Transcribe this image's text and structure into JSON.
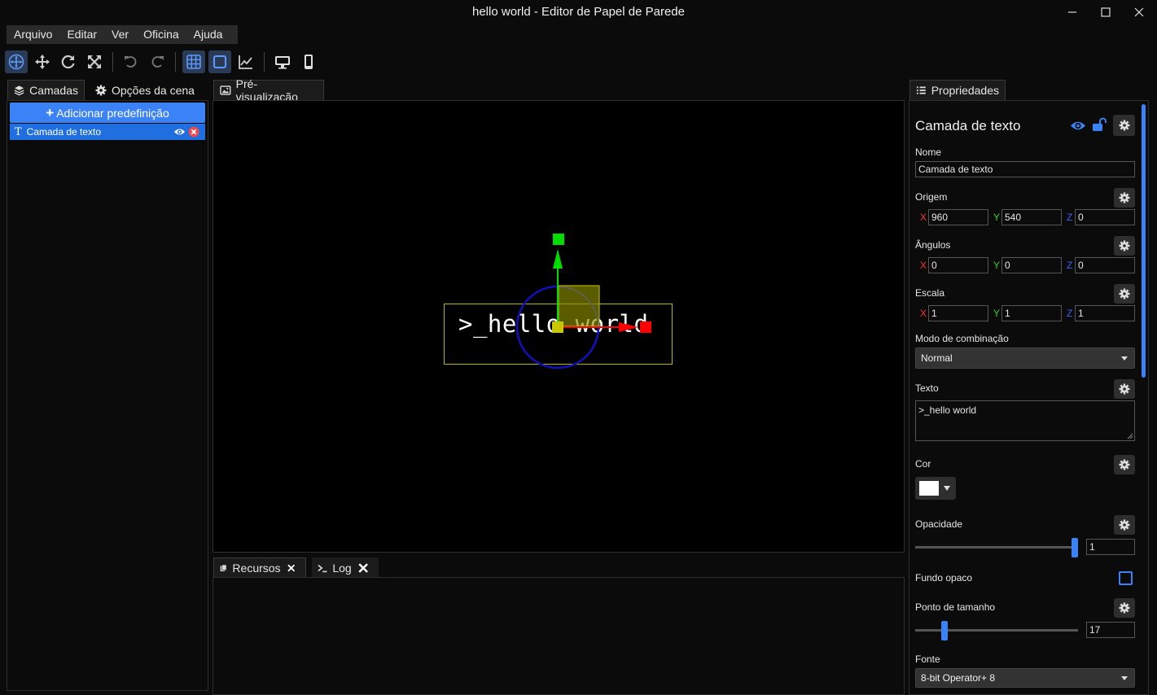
{
  "window": {
    "title": "hello world - Editor de Papel de Parede"
  },
  "menu": [
    "Arquivo",
    "Editar",
    "Ver",
    "Oficina",
    "Ajuda"
  ],
  "left_tabs": {
    "layers": "Camadas",
    "scene_options": "Opções da cena"
  },
  "layers_panel": {
    "add_preset": "Adicionar predefinição",
    "layer_name": "Camada de texto"
  },
  "preview_tab": "Pré-visualização",
  "preview_text": ">_hello world",
  "bottom_tabs": {
    "resources": "Recursos",
    "log": "Log"
  },
  "properties": {
    "tab": "Propriedades",
    "header": "Camada de texto",
    "name_label": "Nome",
    "name_value": "Camada de texto",
    "origin_label": "Origem",
    "origin": {
      "x": "960",
      "y": "540",
      "z": "0"
    },
    "angles_label": "Ângulos",
    "angles": {
      "x": "0",
      "y": "0",
      "z": "0"
    },
    "scale_label": "Escala",
    "scale": {
      "x": "1",
      "y": "1",
      "z": "1"
    },
    "axis": {
      "x": "X",
      "y": "Y",
      "z": "Z"
    },
    "blend_label": "Modo de combinação",
    "blend_value": "Normal",
    "text_label": "Texto",
    "text_value": ">_hello world",
    "color_label": "Cor",
    "opacity_label": "Opacidade",
    "opacity_value": "1",
    "opacity_fraction": 1.0,
    "opaque_bg_label": "Fundo opaco",
    "point_size_label": "Ponto de tamanho",
    "point_size_value": "17",
    "font_label": "Fonte",
    "font_value": "8-bit Operator+ 8"
  },
  "colors": {
    "accent": "#3b82f6",
    "background": "#0b0b0b",
    "gizmo_x": "#ff0000",
    "gizmo_y": "#00dd00",
    "gizmo_circle": "#1010c0",
    "bounds": "#b8b800"
  }
}
